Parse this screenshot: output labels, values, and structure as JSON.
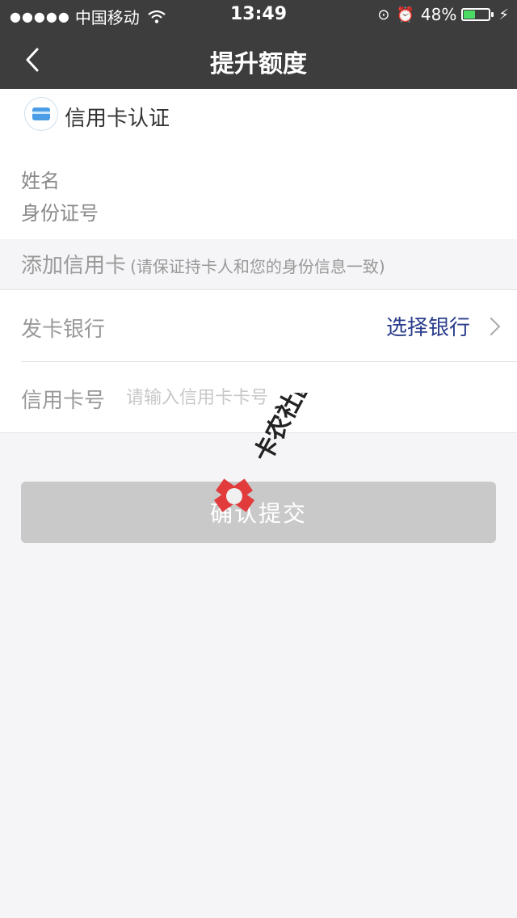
{
  "status_bar": {
    "signal": "●●●●●",
    "carrier": "中国移动",
    "time": "13:49",
    "battery_percent": "48%",
    "battery_level": 0.48,
    "icons": [
      "wifi-icon",
      "rotation-lock-icon",
      "alarm-icon",
      "battery-icon",
      "charging-icon"
    ]
  },
  "nav": {
    "title": "提升额度",
    "back_icon": "chevron-left-icon"
  },
  "section": {
    "title": "信用卡认证",
    "icon": "credit-card-icon"
  },
  "identity": {
    "name_label": "姓名",
    "id_label": "身份证号"
  },
  "add_card": {
    "title": "添加信用卡",
    "note": "(请保证持卡人和您的身份信息一致)"
  },
  "form": {
    "bank_label": "发卡银行",
    "bank_select": "选择银行",
    "card_label": "信用卡号",
    "card_placeholder": "请输入信用卡卡号",
    "card_value": ""
  },
  "submit": {
    "label": "确认提交"
  },
  "watermark": {
    "text": "卡农社区"
  },
  "colors": {
    "nav_bg": "#3d3d3d",
    "page_bg": "#f5f5f7",
    "link": "#2a3d8c",
    "button_disabled": "#c9c9c9",
    "battery": "#4cd964",
    "card_icon": "#4b9de6",
    "watermark": "#e23b3b"
  }
}
